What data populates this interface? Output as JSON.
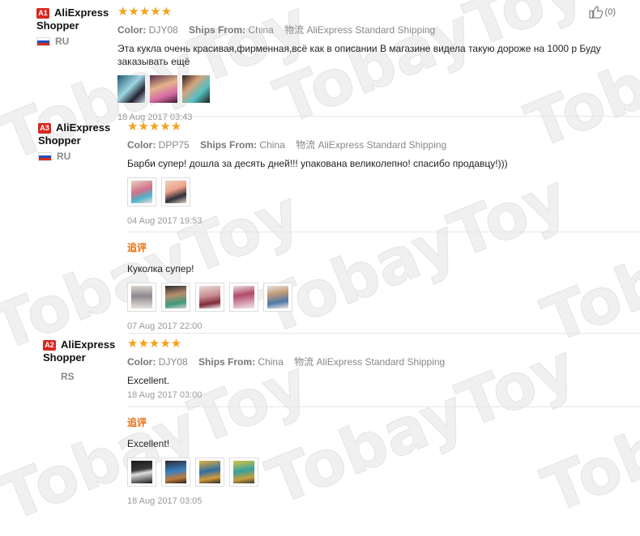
{
  "watermark": "TobayToy",
  "reviews": [
    {
      "badge": "A1",
      "name": "AliExpress Shopper",
      "country": "RU",
      "stars": "★★★★★",
      "color_label": "Color:",
      "color_value": "DJY08",
      "ships_label": "Ships From:",
      "ships_value": "China",
      "shipping_label": "物流",
      "shipping_value": "AliExpress Standard Shipping",
      "text": "Эта кукла очень красивая,фирменная,всё как в описании В магазине видела такую дороже на 1000 р Буду заказывать ещё",
      "date": "18 Aug 2017 03:43",
      "helpful_count": "(0)"
    },
    {
      "badge": "A3",
      "name": "AliExpress Shopper",
      "country": "RU",
      "stars": "★★★★★",
      "color_label": "Color:",
      "color_value": "DPP75",
      "ships_label": "Ships From:",
      "ships_value": "China",
      "shipping_label": "物流",
      "shipping_value": "AliExpress Standard Shipping",
      "text": "Барби супер! дошла за десять дней!!! упакована великолепно! спасибо продавцу!)))",
      "date": "04 Aug 2017 19:53",
      "append_label": "追评",
      "append_text": "Куколка супер!",
      "append_date": "07 Aug 2017 22:00"
    },
    {
      "badge": "A2",
      "name": "AliExpress Shopper",
      "country": "RS",
      "stars": "★★★★★",
      "color_label": "Color:",
      "color_value": "DJY08",
      "ships_label": "Ships From:",
      "ships_value": "China",
      "shipping_label": "物流",
      "shipping_value": "AliExpress Standard Shipping",
      "text": "Excellent.",
      "date": "18 Aug 2017 03:00",
      "append_label": "追评",
      "append_text": "Excellent!",
      "append_date": "18 Aug 2017 03:05"
    }
  ],
  "colors": {
    "badge": "#d8271f",
    "stars": "#f3a21b",
    "append": "#e86c0c"
  },
  "icons": {
    "helpful": "thumbs-up-icon",
    "flag_ru": "russia-flag-icon"
  }
}
